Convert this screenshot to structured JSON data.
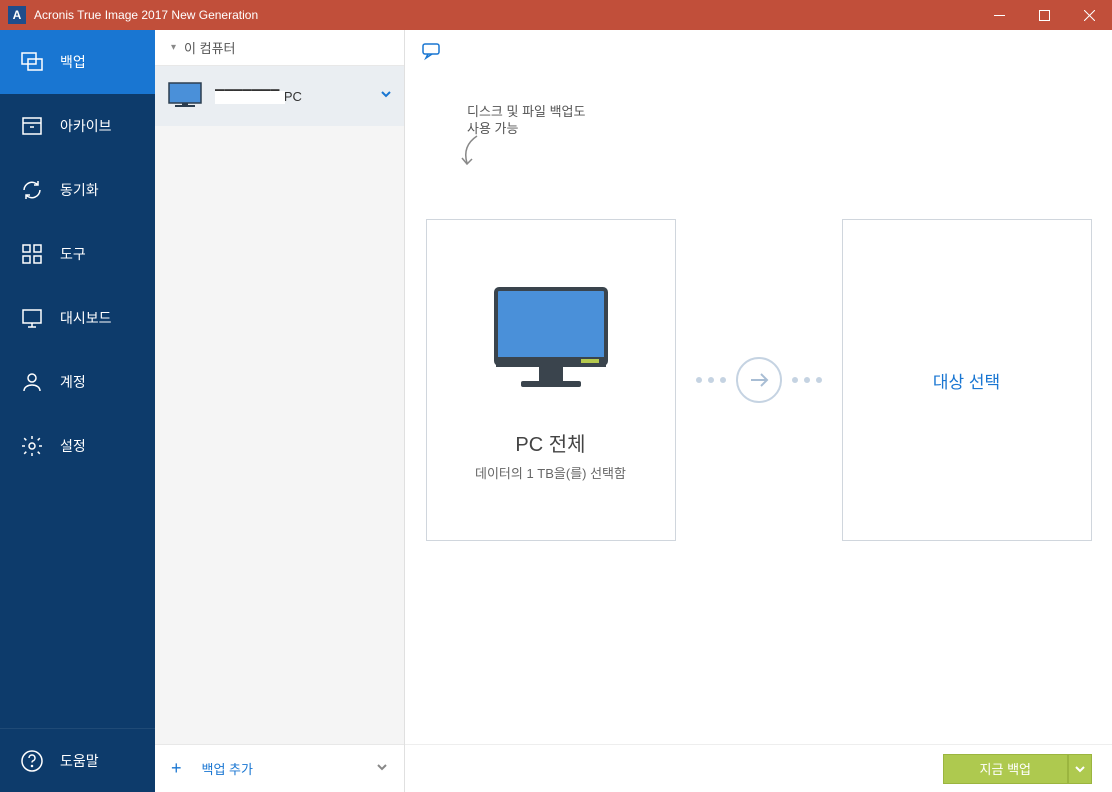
{
  "titlebar": {
    "title": "Acronis True Image 2017 New Generation",
    "logo_letter": "A"
  },
  "sidebar": {
    "items": [
      {
        "label": "백업",
        "icon": "backup"
      },
      {
        "label": "아카이브",
        "icon": "archive"
      },
      {
        "label": "동기화",
        "icon": "sync"
      },
      {
        "label": "도구",
        "icon": "tools"
      },
      {
        "label": "대시보드",
        "icon": "dashboard"
      },
      {
        "label": "계정",
        "icon": "account"
      },
      {
        "label": "설정",
        "icon": "settings"
      }
    ],
    "help_label": "도움말"
  },
  "secondary": {
    "header_label": "이 컴퓨터",
    "item_label": "-PC",
    "add_label": "백업 추가"
  },
  "main": {
    "hint_line1": "디스크 및 파일 백업도",
    "hint_line2": "사용 가능",
    "source_title": "PC 전체",
    "source_sub": "데이터의 1 TB을(를) 선택함",
    "dest_label": "대상 선택",
    "backup_now": "지금 백업"
  }
}
